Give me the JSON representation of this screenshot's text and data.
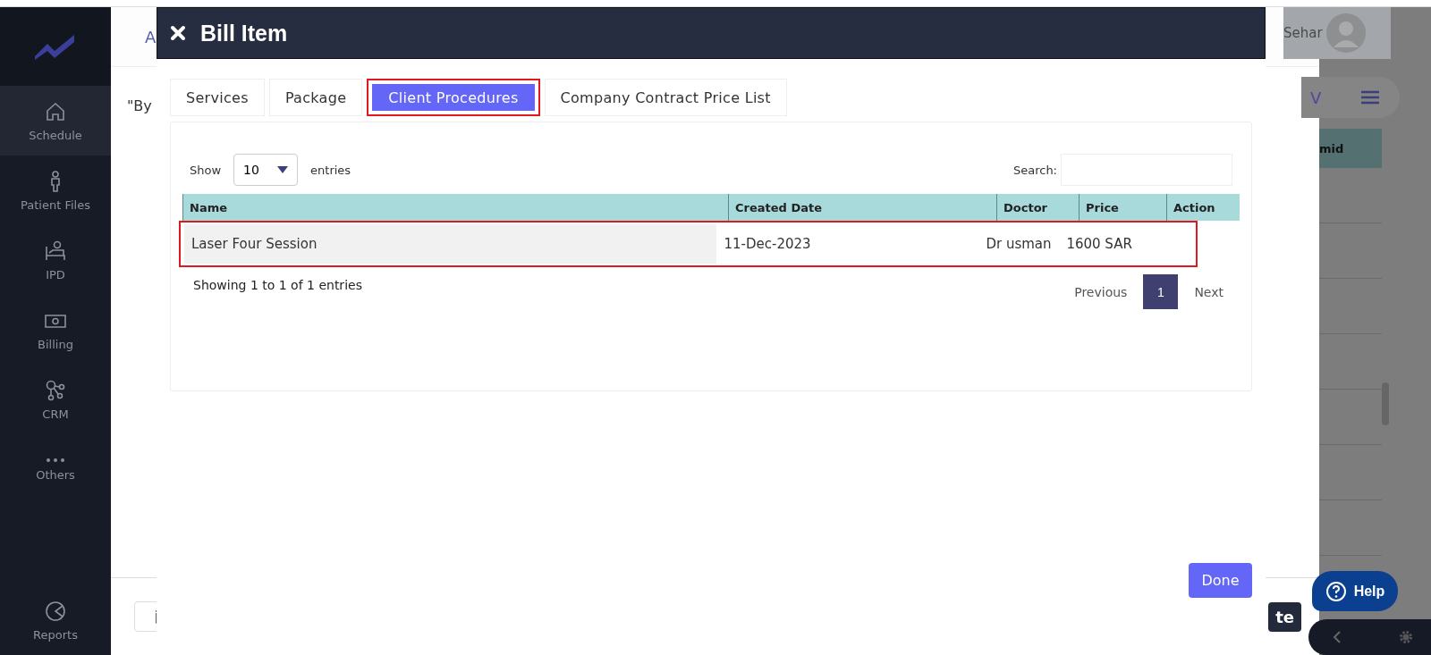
{
  "sidebar": {
    "items": [
      {
        "label": "Schedule",
        "selected": true
      },
      {
        "label": "Patient Files",
        "selected": false
      },
      {
        "label": "IPD",
        "selected": false
      },
      {
        "label": "Billing",
        "selected": false
      },
      {
        "label": "CRM",
        "selected": false
      },
      {
        "label": "Others",
        "selected": false
      }
    ],
    "bottom_item": {
      "label": "Reports",
      "selected": false
    }
  },
  "background_panel": {
    "tab_fragment": "A",
    "text_fragment": "\"By",
    "button_fragment": "te"
  },
  "background_page": {
    "user_name": "Sehar",
    "view_fragment": "V",
    "column_fragment": "mid"
  },
  "help_button": {
    "label": "Help"
  },
  "modal": {
    "title": "Bill Item",
    "tabs": [
      {
        "label": "Services",
        "selected": false,
        "highlighted": false
      },
      {
        "label": "Package",
        "selected": false,
        "highlighted": false
      },
      {
        "label": "Client Procedures",
        "selected": true,
        "highlighted": true
      },
      {
        "label": "Company Contract Price List",
        "selected": false,
        "highlighted": false
      }
    ],
    "table": {
      "show_label": "Show",
      "page_length": "10",
      "entries_label": "entries",
      "search_label": "Search:",
      "columns": [
        "Name",
        "Created Date",
        "Doctor",
        "Price",
        "Action"
      ],
      "rows": [
        {
          "cells": [
            "Laser Four Session",
            "11-Dec-2023",
            "Dr usman",
            "1600 SAR",
            ""
          ],
          "highlighted": true
        }
      ],
      "info": "Showing 1 to 1 of 1 entries",
      "pagination": {
        "previous": "Previous",
        "pages": [
          {
            "label": "1",
            "selected": true
          }
        ],
        "next": "Next"
      }
    },
    "done_button": "Done"
  }
}
